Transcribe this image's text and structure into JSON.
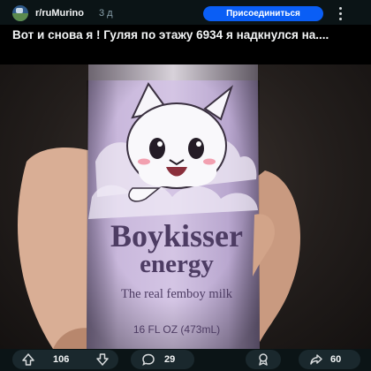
{
  "post": {
    "subreddit": "r/ruMurino",
    "time": "3 д",
    "join_label": "Присоединиться",
    "title": "Вот и снова я ! Гуляя по этажу 6934 я надкнулся на...."
  },
  "image": {
    "can_brand_line1": "Boykisser",
    "can_brand_line2": "energy",
    "can_tagline": "The real femboy milk",
    "can_volume": "16 FL OZ (473mL)"
  },
  "actions": {
    "upvotes": "106",
    "comments": "29",
    "shares": "60"
  },
  "colors": {
    "join_button": "#0a5ef5",
    "background": "#0b1416",
    "pill": "#1a282d",
    "can_lavender": "#c4b3d8"
  },
  "icons": [
    "more-vertical-icon",
    "upvote-icon",
    "downvote-icon",
    "comment-icon",
    "award-icon",
    "share-icon"
  ]
}
